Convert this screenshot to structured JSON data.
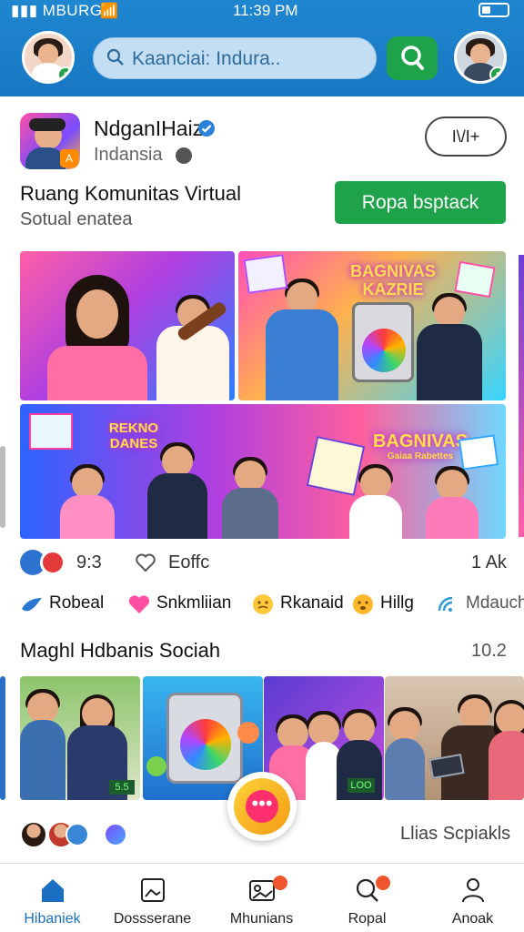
{
  "status_bar": {
    "carrier": "MBURG",
    "time": "11:39 PM"
  },
  "header": {
    "search": {
      "placeholder": "Kaanciai: Indura.."
    }
  },
  "profile": {
    "name": "NdganIHaiz",
    "location": "Indansia",
    "follow_label": "I\\/I+",
    "community_title": "Ruang Komunitas Virtual",
    "community_subtitle": "Sotual enatea",
    "primary_button": "Ropa bsptack"
  },
  "media": {
    "m2_banner": "BAGNIVAS KAZRIE",
    "m3_banner_left": "REKNO DANES",
    "m3_banner_right": "BAGNIVAS",
    "m3_banner_right_sub": "Gaiaa Rabettes"
  },
  "reactions": {
    "count": "9:3",
    "heart_label": "Eoffc",
    "shares": "1 Ak"
  },
  "chips": [
    {
      "label": "Robeal",
      "icon": "bird-icon"
    },
    {
      "label": "Snkmliian",
      "icon": "heart-icon"
    },
    {
      "label": "Rkanaid",
      "icon": "emoji-icon"
    },
    {
      "label": "Hillg",
      "icon": "emoji-icon"
    },
    {
      "label": "Mdauch",
      "icon": "wifi-icon"
    }
  ],
  "section": {
    "title": "Maghl Hdbanis Sociah",
    "meta": "10.2"
  },
  "thumbnails": {
    "t1_tag": "5.5",
    "t3_tag": "LOO"
  },
  "footer": {
    "stack_label": "Llias Scpiakls"
  },
  "bottom_nav": [
    {
      "label": "Hibaniek",
      "icon": "home-icon"
    },
    {
      "label": "Dossserane",
      "icon": "image-icon"
    },
    {
      "label": "Mhunians",
      "icon": "gallery-icon"
    },
    {
      "label": "Ropal",
      "icon": "search-icon"
    },
    {
      "label": "Anoak",
      "icon": "person-icon"
    }
  ],
  "colors": {
    "primary_blue": "#1877c2",
    "accent_green": "#1fa34a",
    "badge_orange": "#f0562d"
  }
}
